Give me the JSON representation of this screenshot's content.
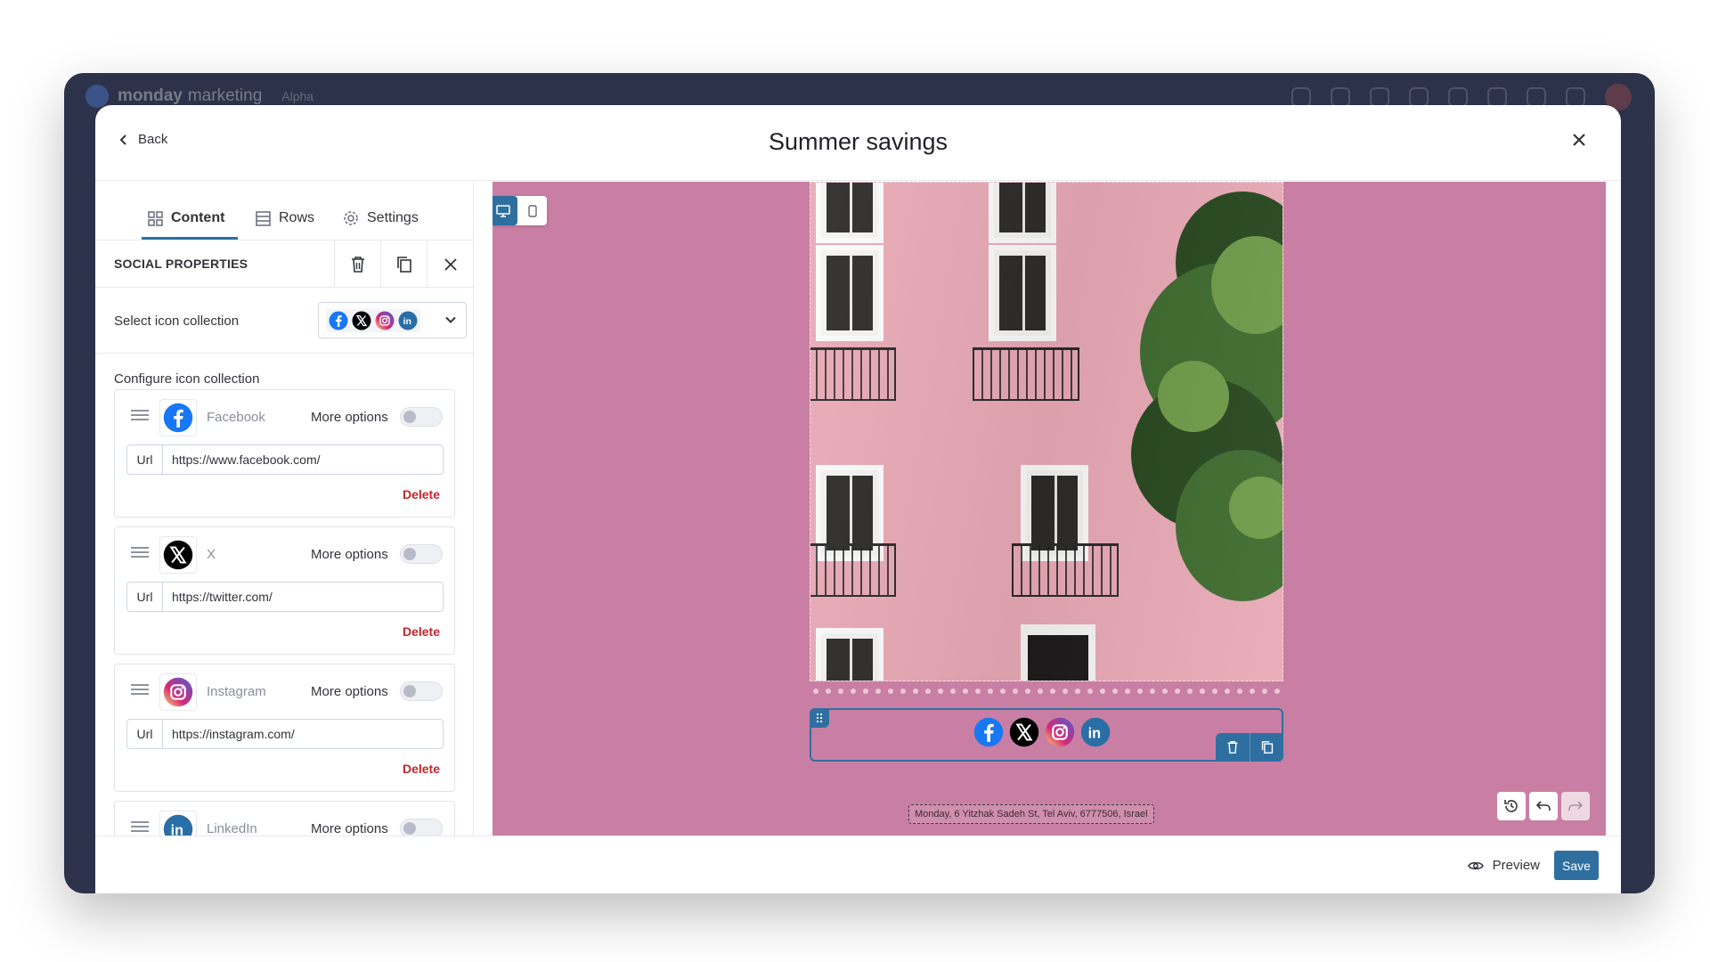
{
  "app": {
    "name": "monday",
    "product": "marketing",
    "badge": "Alpha"
  },
  "modal": {
    "back_label": "Back",
    "title": "Summer savings"
  },
  "tabs": [
    {
      "label": "Content",
      "icon": "grid-icon",
      "active": true
    },
    {
      "label": "Rows",
      "icon": "rows-icon",
      "active": false
    },
    {
      "label": "Settings",
      "icon": "gear-icon",
      "active": false
    }
  ],
  "properties": {
    "title": "SOCIAL PROPERTIES",
    "select_label": "Select icon collection",
    "configure_label": "Configure icon collection",
    "more_options_label": "More options",
    "url_addon": "Url",
    "delete_label": "Delete"
  },
  "icons": [
    {
      "name": "Facebook",
      "url": "https://www.facebook.com/",
      "icon": "facebook-icon",
      "color": "#1877f2",
      "more_options": false
    },
    {
      "name": "X",
      "url": "https://twitter.com/",
      "icon": "x-icon",
      "color": "#000000",
      "more_options": false
    },
    {
      "name": "Instagram",
      "url": "https://instagram.com/",
      "icon": "instagram-icon",
      "color": "#d62976",
      "more_options": false
    },
    {
      "name": "LinkedIn",
      "url": "",
      "icon": "linkedin-icon",
      "color": "#2a6ea6",
      "more_options": false
    }
  ],
  "canvas": {
    "background": "#c97fa3",
    "footer_address": "Monday, 6 Yitzhak Sadeh St, Tel Aviv, 6777506, Israel"
  },
  "footer": {
    "preview_label": "Preview",
    "save_label": "Save"
  },
  "colors": {
    "accent": "#2f6fa0",
    "danger": "#c0272d"
  }
}
